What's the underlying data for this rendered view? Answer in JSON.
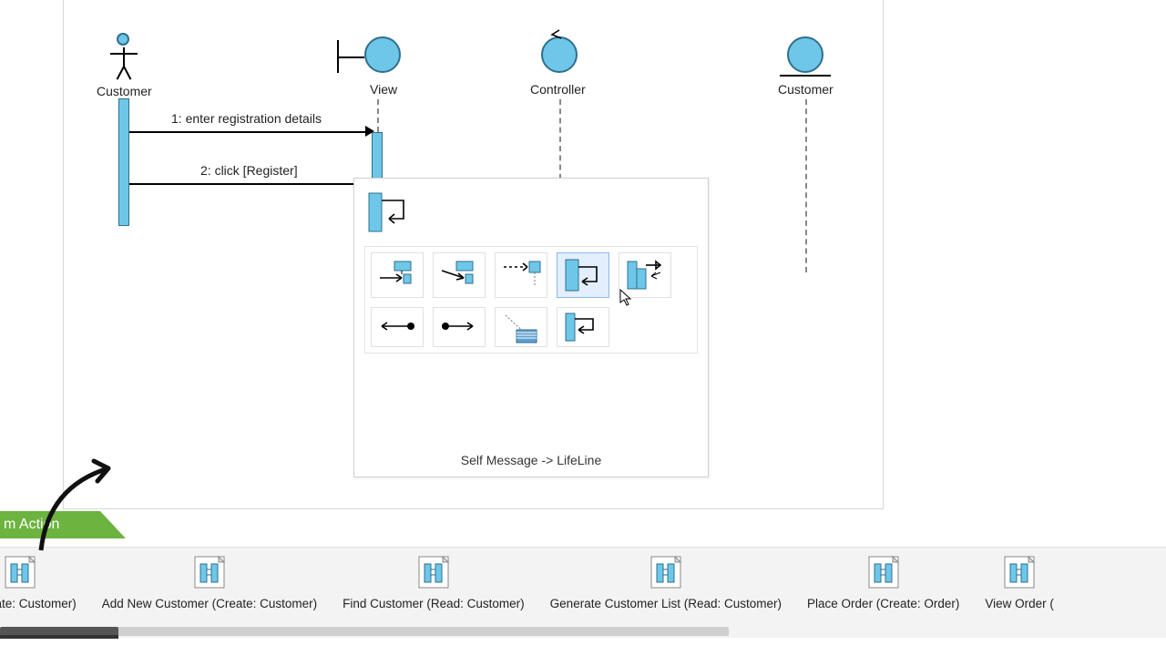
{
  "lifelines": {
    "customer_actor": {
      "label": "Customer"
    },
    "view": {
      "label": "View"
    },
    "controller": {
      "label": "Controller"
    },
    "customer_entity": {
      "label": "Customer"
    }
  },
  "messages": {
    "m1": {
      "text": "1: enter registration details"
    },
    "m2": {
      "text": "2: click [Register]"
    }
  },
  "popup": {
    "hint": "Self Message -> LifeLine",
    "tools": [
      {
        "name": "message-call",
        "row": 1
      },
      {
        "name": "message-async-call",
        "row": 1
      },
      {
        "name": "create-message",
        "row": 1
      },
      {
        "name": "self-message",
        "row": 1,
        "selected": true
      },
      {
        "name": "recursive-message",
        "row": 1
      },
      {
        "name": "found-message",
        "row": 2
      },
      {
        "name": "lost-message",
        "row": 2
      },
      {
        "name": "note",
        "row": 2
      },
      {
        "name": "self-call-compact",
        "row": 2
      }
    ]
  },
  "banner": {
    "text": "m Action"
  },
  "bottom_items": [
    {
      "label": "r (Create: Customer)"
    },
    {
      "label": "Add New Customer (Create: Customer)"
    },
    {
      "label": "Find Customer (Read: Customer)"
    },
    {
      "label": "Generate Customer List (Read: Customer)"
    },
    {
      "label": "Place Order (Create: Order)"
    },
    {
      "label": "View Order ("
    }
  ]
}
